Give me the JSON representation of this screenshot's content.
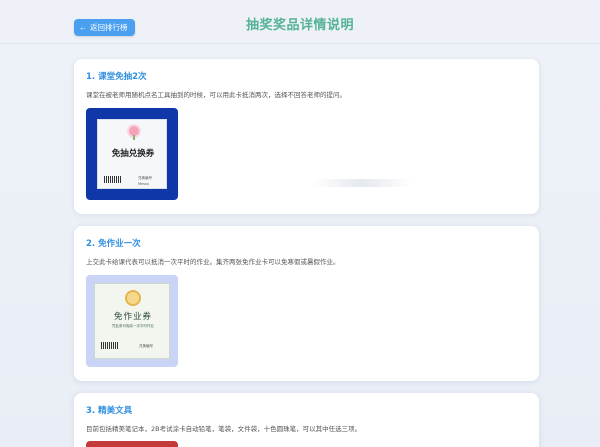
{
  "header": {
    "back_label": "返回排行榜",
    "title": "抽奖奖品详情说明"
  },
  "prizes": [
    {
      "title": "1. 课堂免抽2次",
      "description": "课堂在被老师用随机点名工具抽到的时候，可以用此卡抵消两次，选择不回答老师的提问。",
      "coupon_label": "免抽兑换券",
      "coupon_meta": "兑换编号",
      "coupon_name": "Mmoo"
    },
    {
      "title": "2. 免作业一次",
      "description": "上交此卡给课代表可以抵消一次平时的作业。集齐两张免作业卡可以免寒假或暑假作业。",
      "coupon_label": "免作业券",
      "coupon_note": "凭此券可免除一次平时作业",
      "coupon_meta": "兑换编号"
    },
    {
      "title": "3. 精美文具",
      "description": "目前包括精美笔记本，2B考试涂卡自动铅笔，笔袋，文件袋，十色圆珠笔，可以其中任选三项。"
    }
  ]
}
